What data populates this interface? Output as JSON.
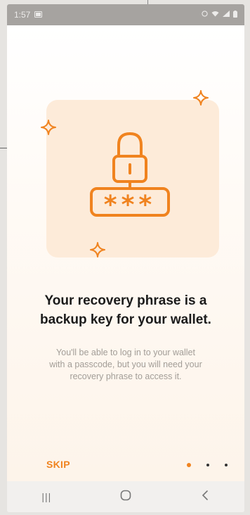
{
  "status_bar": {
    "time": "1:57",
    "icons": [
      "notification-icon",
      "alarm-icon",
      "wifi-icon",
      "signal-icon",
      "battery-icon"
    ]
  },
  "onboarding": {
    "headline_line1": "Your recovery phrase is a",
    "headline_line2": "backup key for your wallet.",
    "body_line1": "You'll be able to log in to your wallet",
    "body_line2": "with a passcode, but you will need your",
    "body_line3": "recovery phrase to access it.",
    "illustration_text": "***",
    "skip_label": "SKIP",
    "pagination": {
      "total": 3,
      "active": 1
    }
  },
  "nav_bar": {
    "recents_glyph": "|||",
    "home_glyph": "○",
    "back_glyph": "<"
  },
  "colors": {
    "accent": "#f0831f",
    "hero_bg": "#fdebd9",
    "text_primary": "#1b1b1b",
    "text_secondary": "#a29d97"
  }
}
